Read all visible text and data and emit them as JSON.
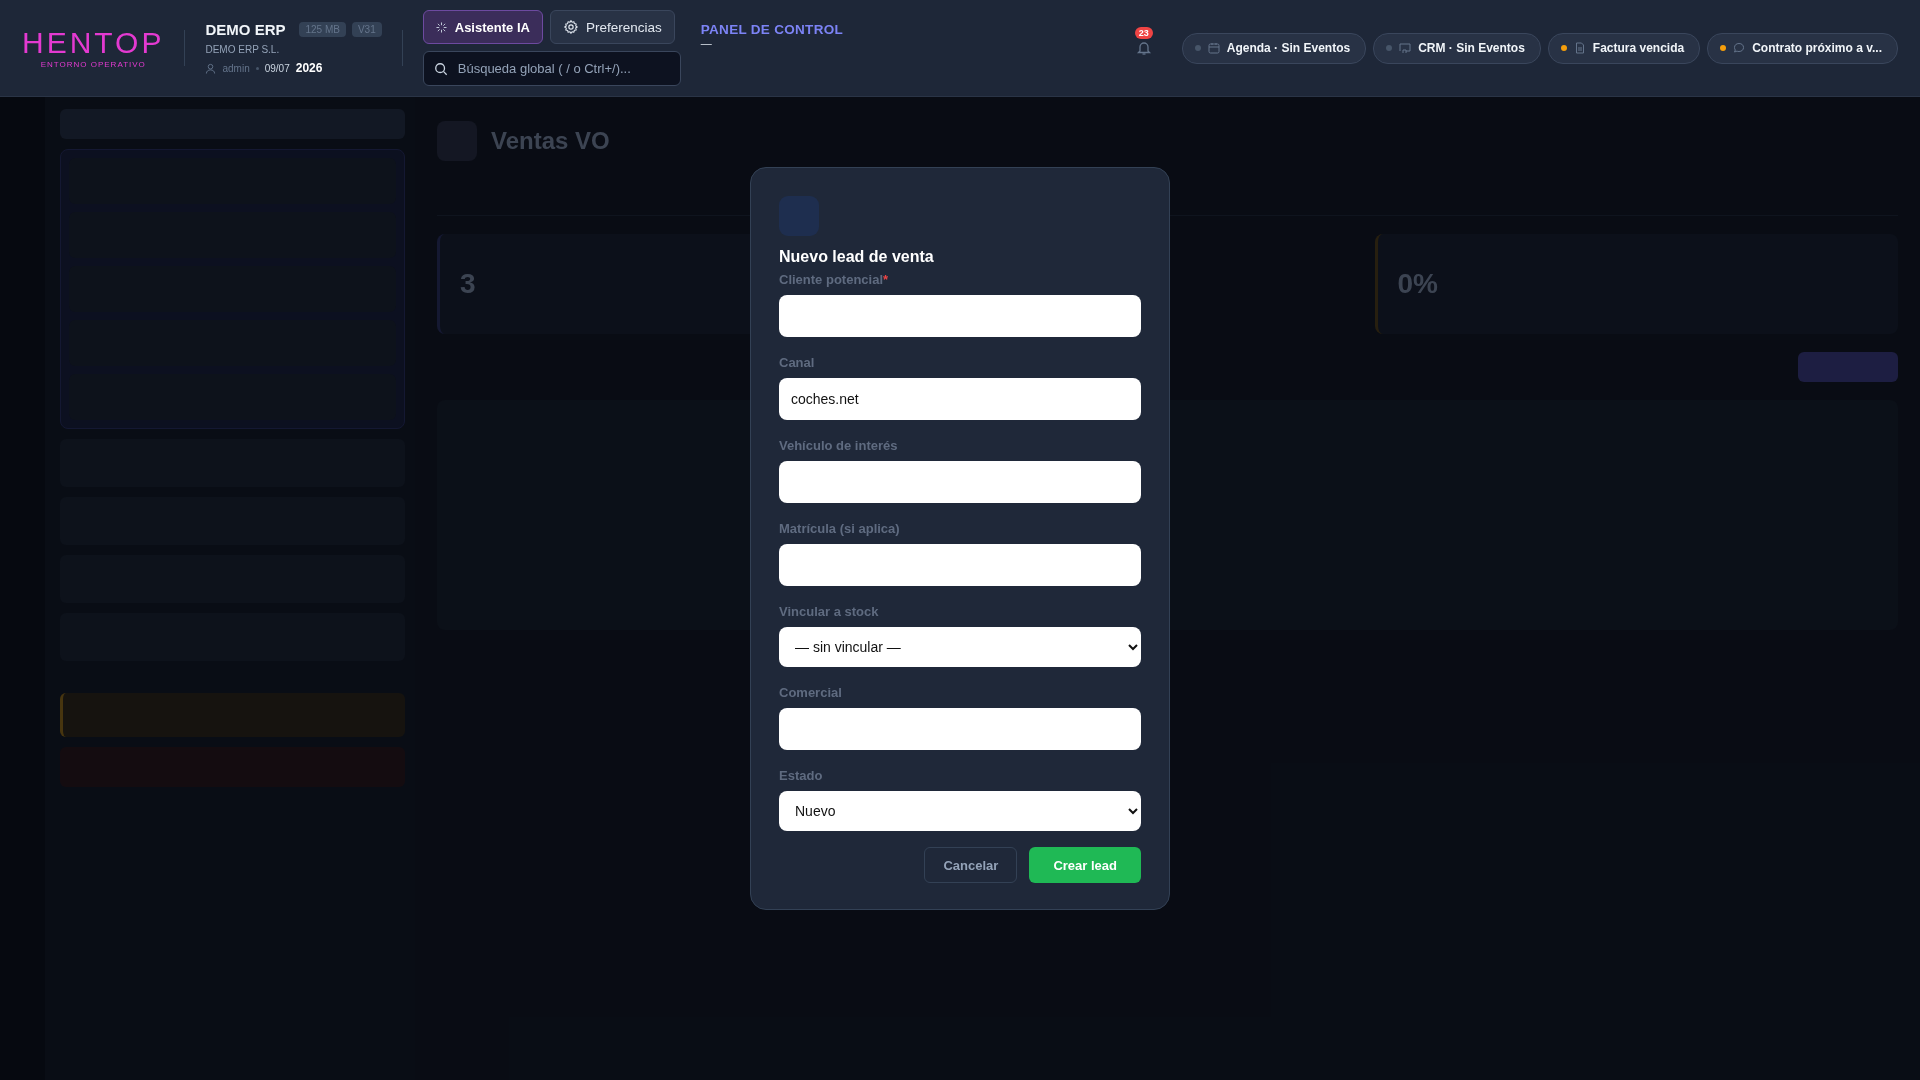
{
  "header": {
    "logo": "HENTOP",
    "logo_tagline": "ENTORNO OPERATIVO",
    "company": "DEMO ERP",
    "badges": [
      "125 MB",
      "V31"
    ],
    "legal_name": "DEMO ERP S.L.",
    "user": "admin",
    "date": "09/07",
    "year": "2026",
    "assistant_button": "Asistente IA",
    "preferences_button": "Preferencias",
    "search": {
      "placeholder": "Búsqueda global ( / o Ctrl+/)..."
    },
    "section_title": "PANEL DE CONTROL",
    "section_subtitle": "—",
    "notifications": "23",
    "chips": [
      {
        "label": "Agenda · Sin Eventos",
        "color": "#475569",
        "kind": "calendar"
      },
      {
        "label": "CRM · Sin Eventos",
        "color": "#475569",
        "kind": "screen"
      },
      {
        "label": "Factura vencida",
        "color": "#f59e0b",
        "kind": "document"
      },
      {
        "label": "Contrato próximo a v...",
        "color": "#f59e0b",
        "kind": "chat"
      }
    ]
  },
  "page": {
    "title": "Ventas VO",
    "stats": [
      "3",
      "0%"
    ]
  },
  "modal": {
    "title": "Nuevo lead de venta",
    "required_mark": "*",
    "fields": [
      {
        "label": "Cliente potencial",
        "required": true,
        "kind": "input"
      },
      {
        "label": "Canal",
        "required": false,
        "kind": "input",
        "value": "coches.net"
      },
      {
        "label": "Vehículo de interés",
        "required": false,
        "kind": "input"
      },
      {
        "label": "Matrícula (si aplica)",
        "required": false,
        "kind": "input"
      },
      {
        "label": "Vincular a stock",
        "required": false,
        "kind": "select",
        "value": "— sin vincular —"
      },
      {
        "label": "Comercial",
        "required": false,
        "kind": "input"
      },
      {
        "label": "Estado",
        "required": false,
        "kind": "select",
        "value": "Nuevo"
      }
    ],
    "buttons": [
      {
        "label": "Cancelar",
        "kind": "secondary"
      },
      {
        "label": "Crear lead",
        "kind": "primary"
      }
    ]
  }
}
